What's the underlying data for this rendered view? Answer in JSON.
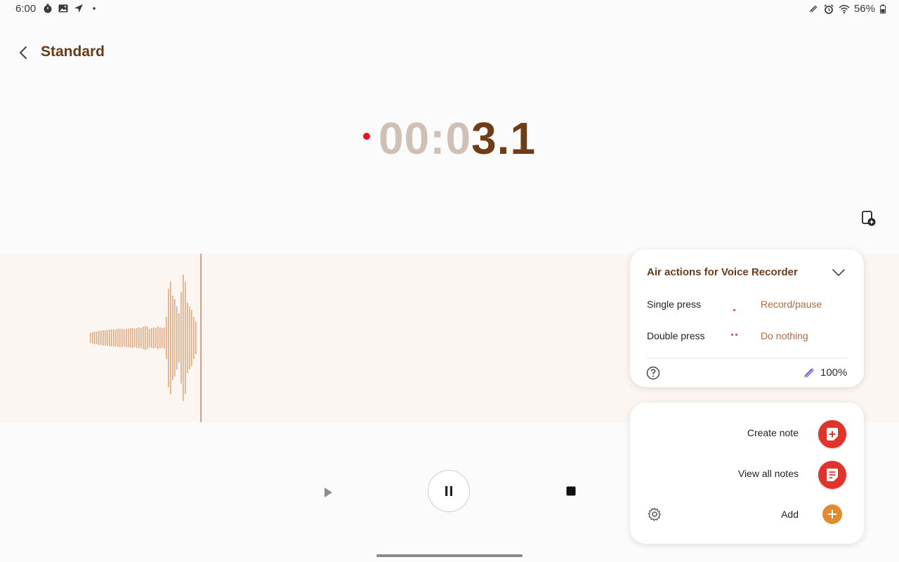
{
  "status": {
    "time": "6:00",
    "battery": "56%"
  },
  "header": {
    "title": "Standard"
  },
  "timer": {
    "dim_part": "00:0",
    "bright_part": "3.1"
  },
  "air_actions": {
    "title": "Air actions for Voice Recorder",
    "rows": [
      {
        "label": "Single press",
        "value": "Record/pause"
      },
      {
        "label": "Double press",
        "value": "Do nothing"
      }
    ],
    "pen_battery": "100%"
  },
  "notes": {
    "create_label": "Create note",
    "view_label": "View all notes",
    "add_label": "Add"
  },
  "colors": {
    "accent": "#6a3b18",
    "record": "#e3161b",
    "waveform": "#e0a97e",
    "note_button": "#e0332b",
    "add_button": "#e38a2f"
  }
}
